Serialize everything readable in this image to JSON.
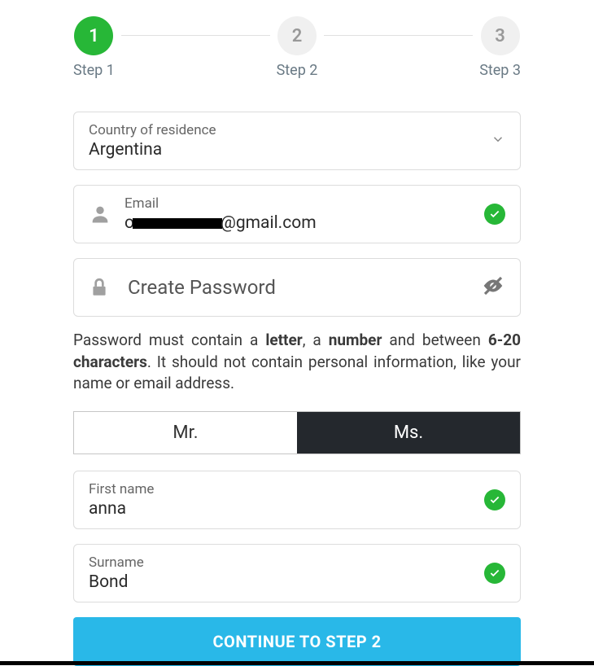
{
  "stepper": {
    "steps": [
      {
        "number": "1",
        "label": "Step 1",
        "state": "active"
      },
      {
        "number": "2",
        "label": "Step 2",
        "state": "inactive"
      },
      {
        "number": "3",
        "label": "Step 3",
        "state": "inactive"
      }
    ]
  },
  "country": {
    "label": "Country of residence",
    "value": "Argentina"
  },
  "email": {
    "label": "Email",
    "prefix": "o",
    "suffix": "@gmail.com",
    "valid": true
  },
  "password": {
    "placeholder": "Create Password",
    "hint_parts": {
      "p1": "Password must contain a ",
      "b1": "letter",
      "p2": ", a ",
      "b2": "number",
      "p3": " and between ",
      "b3": "6-20 characters",
      "p4": ". It should not contain personal information, like your name or email address."
    }
  },
  "title_toggle": {
    "option_mr": "Mr.",
    "option_ms": "Ms.",
    "selected": "Ms."
  },
  "first_name": {
    "label": "First name",
    "value": "anna",
    "valid": true
  },
  "surname": {
    "label": "Surname",
    "value": "Bond",
    "valid": true
  },
  "continue_button": "CONTINUE TO STEP 2"
}
